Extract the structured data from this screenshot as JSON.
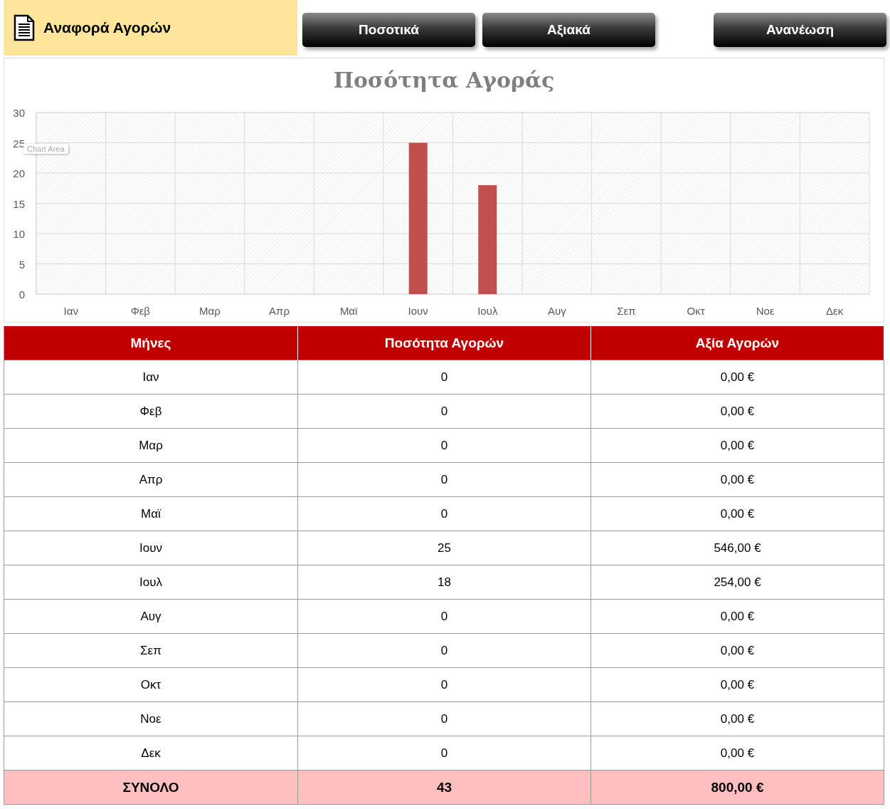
{
  "header": {
    "title": "Αναφορά Αγορών"
  },
  "buttons": [
    {
      "label": "Ποσοτικά",
      "kind": "nav"
    },
    {
      "label": "Αξιακά",
      "kind": "nav"
    },
    {
      "label": "Ανανέωση",
      "kind": "action"
    }
  ],
  "chart": {
    "tooltip": "Chart Area",
    "chart_data": {
      "type": "bar",
      "title": "Ποσότητα Αγοράς",
      "categories": [
        "Ιαν",
        "Φεβ",
        "Μαρ",
        "Απρ",
        "Μαϊ",
        "Ιουν",
        "Ιουλ",
        "Αυγ",
        "Σεπ",
        "Οκτ",
        "Νοε",
        "Δεκ"
      ],
      "grid": true,
      "series": [
        {
          "color": "#c0504d",
          "values": [
            0,
            0,
            0,
            0,
            0,
            25,
            18,
            0,
            0,
            0,
            0,
            0
          ]
        }
      ],
      "ylim": [
        0,
        30
      ],
      "yticks": [
        0,
        5,
        10,
        15,
        20,
        25,
        30
      ]
    }
  },
  "table": {
    "columns": [
      "Μήνες",
      "Ποσότητα Αγορών",
      "Αξία Αγορών"
    ],
    "rows": [
      [
        "Ιαν",
        "0",
        "0,00 €"
      ],
      [
        "Φεβ",
        "0",
        "0,00 €"
      ],
      [
        "Μαρ",
        "0",
        "0,00 €"
      ],
      [
        "Απρ",
        "0",
        "0,00 €"
      ],
      [
        "Μαϊ",
        "0",
        "0,00 €"
      ],
      [
        "Ιουν",
        "25",
        "546,00 €"
      ],
      [
        "Ιουλ",
        "18",
        "254,00 €"
      ],
      [
        "Αυγ",
        "0",
        "0,00 €"
      ],
      [
        "Σεπ",
        "0",
        "0,00 €"
      ],
      [
        "Οκτ",
        "0",
        "0,00 €"
      ],
      [
        "Νοε",
        "0",
        "0,00 €"
      ],
      [
        "Δεκ",
        "0",
        "0,00 €"
      ]
    ],
    "total": [
      "ΣΥΝΟΛΟ",
      "43",
      "800,00 €"
    ]
  }
}
